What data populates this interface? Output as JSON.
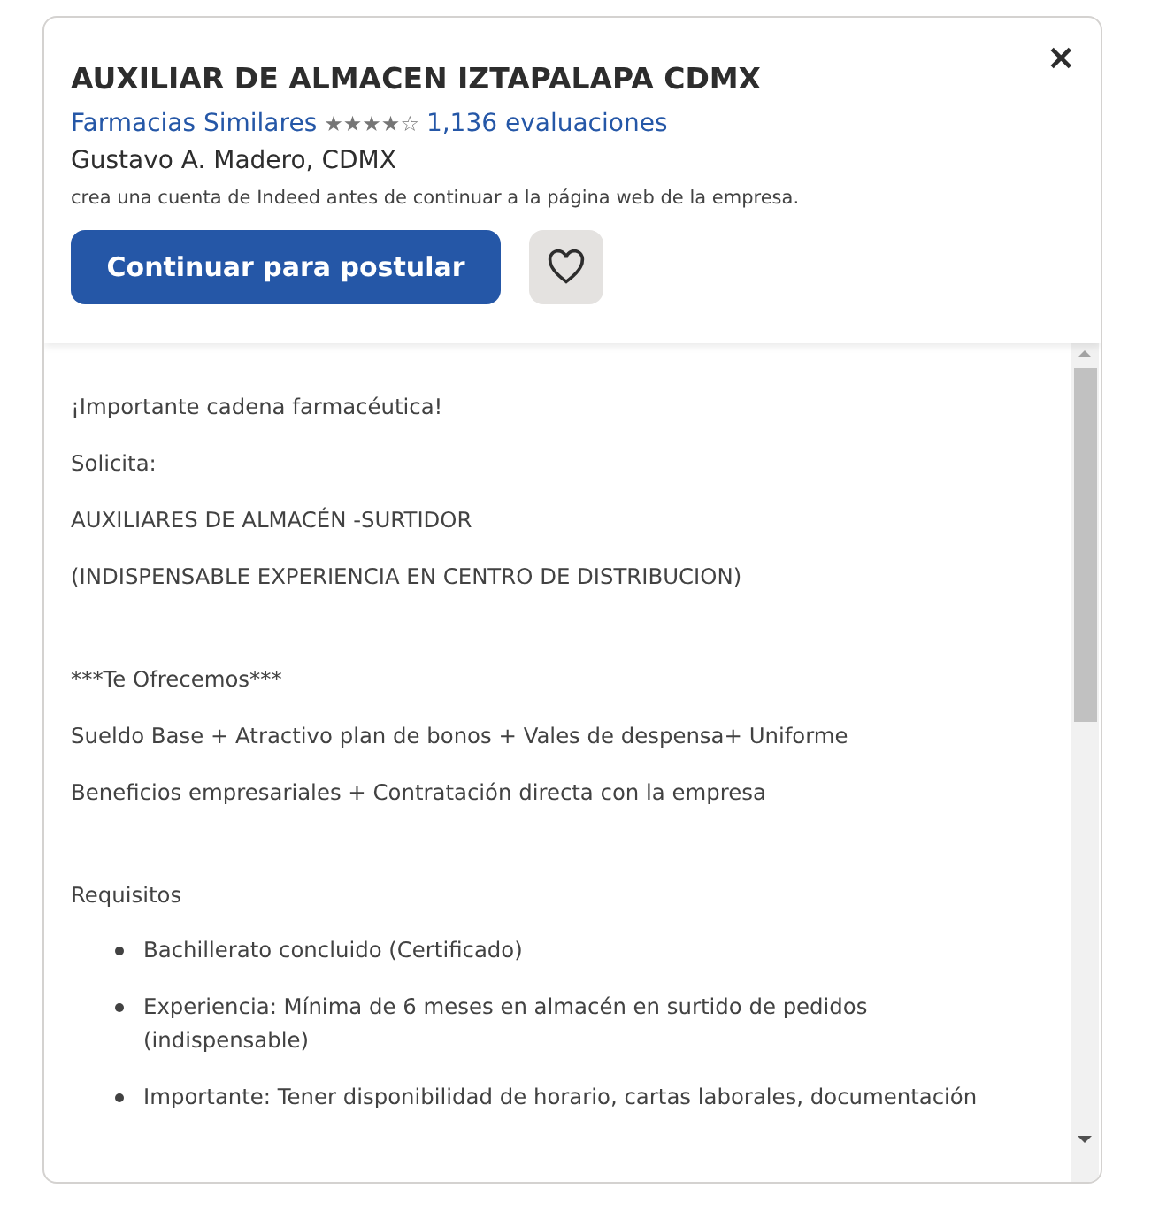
{
  "job": {
    "title": "AUXILIAR DE ALMACEN IZTAPALAPA CDMX",
    "company": "Farmacias Similares",
    "stars": 4,
    "reviews": "1,136 evaluaciones",
    "location": "Gustavo A. Madero, CDMX",
    "notice": "crea una cuenta de Indeed antes de continuar a la página web de la empresa.",
    "apply_button": "Continuar para postular",
    "saved": false,
    "close": "×"
  },
  "description_sections": [
    {
      "paragraphs": [
        "¡Importante cadena farmacéutica!",
        "Solicita:",
        "AUXILIARES DE ALMACÉN -SURTIDOR",
        "(INDISPENSABLE EXPERIENCIA EN CENTRO DE DISTRIBUCION)"
      ]
    },
    {
      "paragraphs": [
        "***Te Ofrecemos***",
        "Sueldo Base + Atractivo plan de bonos + Vales de despensa+ Uniforme",
        "Beneficios empresariales + Contratación directa con la empresa"
      ]
    },
    {
      "paragraphs": [
        "Requisitos"
      ],
      "list": [
        "Bachillerato concluido (Certificado)",
        "Experiencia: Mínima de 6 meses en almacén en surtido de pedidos (indispensable)",
        "Importante: Tener disponibilidad de horario, cartas laborales, documentación"
      ]
    }
  ]
}
